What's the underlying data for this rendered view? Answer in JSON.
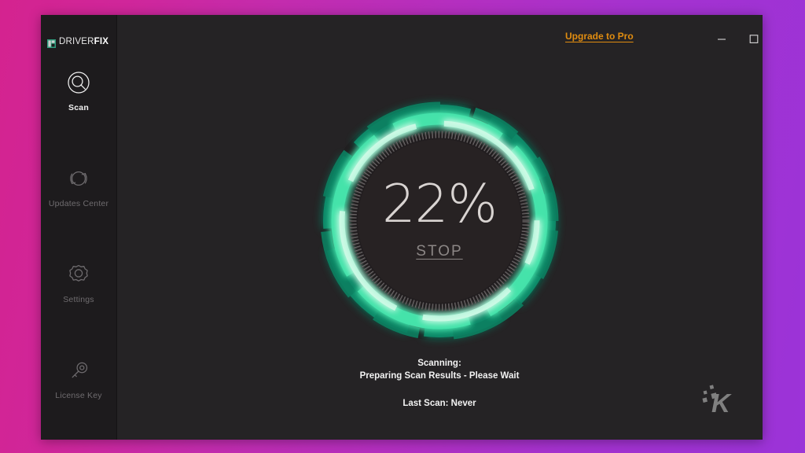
{
  "window": {
    "brand_prefix": "DRIVER",
    "brand_suffix": "FIX",
    "brand_full": "DRIVERFIX",
    "upgrade_label": "Upgrade to Pro",
    "controls": {
      "minimize": "minimize",
      "maximize": "maximize",
      "close": "close"
    }
  },
  "sidebar": {
    "items": [
      {
        "label": "Scan",
        "icon": "scan-icon",
        "active": true
      },
      {
        "label": "Updates Center",
        "icon": "refresh-icon",
        "active": false
      },
      {
        "label": "Settings",
        "icon": "gear-icon",
        "active": false
      },
      {
        "label": "License Key",
        "icon": "key-icon",
        "active": false
      }
    ]
  },
  "scan": {
    "percent_label": "22%",
    "percent_value": 22,
    "stop_label": "STOP",
    "status_title": "Scanning:",
    "status_detail": "Preparing Scan Results - Please Wait",
    "last_scan": "Last Scan: Never"
  },
  "watermark": {
    "letter": "K"
  },
  "colors": {
    "accent_orange": "#e08c10",
    "ring_teal": "#0f9e77",
    "ring_bright": "#8ff2cf",
    "window_bg": "#252325",
    "sidebar_bg": "#1d1b1d",
    "bg_gradient_start": "#d4238f",
    "bg_gradient_end": "#9b33d8"
  }
}
